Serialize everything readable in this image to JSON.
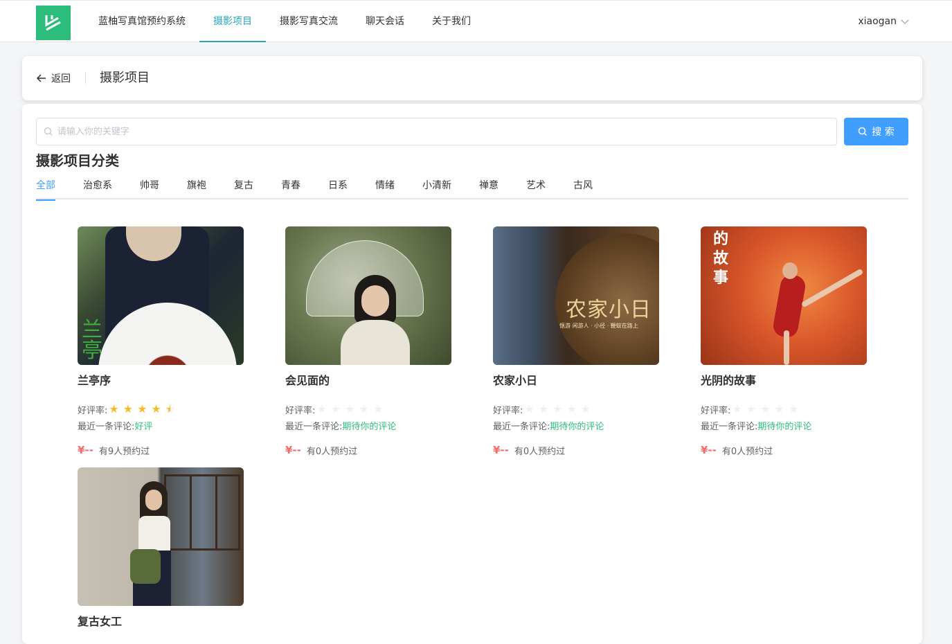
{
  "header": {
    "nav": [
      "蓝柚写真馆预约系统",
      "摄影项目",
      "摄影写真交流",
      "聊天会话",
      "关于我们"
    ],
    "active_nav": "摄影项目",
    "username": "xiaogan"
  },
  "page_header": {
    "back_label": "返回",
    "title": "摄影项目"
  },
  "search": {
    "placeholder": "请输入你的关键字",
    "button_label": "搜 索"
  },
  "categories": {
    "title": "摄影项目分类",
    "tabs": [
      "全部",
      "治愈系",
      "帅哥",
      "旗袍",
      "复古",
      "青春",
      "日系",
      "情绪",
      "小清新",
      "禅意",
      "艺术",
      "古风"
    ],
    "active": "全部"
  },
  "labels": {
    "rating": "好评率:",
    "latest": "最近一条评论:"
  },
  "projects": [
    {
      "name": "兰亭序",
      "rating": 4.5,
      "latest_comment": "好评",
      "price": "¥--",
      "booked": "有9人预约过"
    },
    {
      "name": "会见面的",
      "rating": 0,
      "latest_comment": "期待你的评论",
      "price": "¥--",
      "booked": "有0人预约过"
    },
    {
      "name": "农家小日",
      "rating": 0,
      "latest_comment": "期待你的评论",
      "price": "¥--",
      "booked": "有0人预约过"
    },
    {
      "name": "光阴的故事",
      "rating": 0,
      "latest_comment": "期待你的评论",
      "price": "¥--",
      "booked": "有0人预约过"
    },
    {
      "name": "复古女工"
    }
  ],
  "image_text": {
    "card1": "兰亭",
    "card3_title": "农家小日",
    "card3_sub": "惬游 闲游人 · 小径 · 鞭蚁在路上",
    "card4": [
      "的",
      "故",
      "事"
    ]
  },
  "colors": {
    "accent": "#27a6b8",
    "primary": "#409eff",
    "logo": "#2cbd7d",
    "price": "#f56c6c",
    "star": "#f7ba2a",
    "comment": "#2cbd7d"
  }
}
